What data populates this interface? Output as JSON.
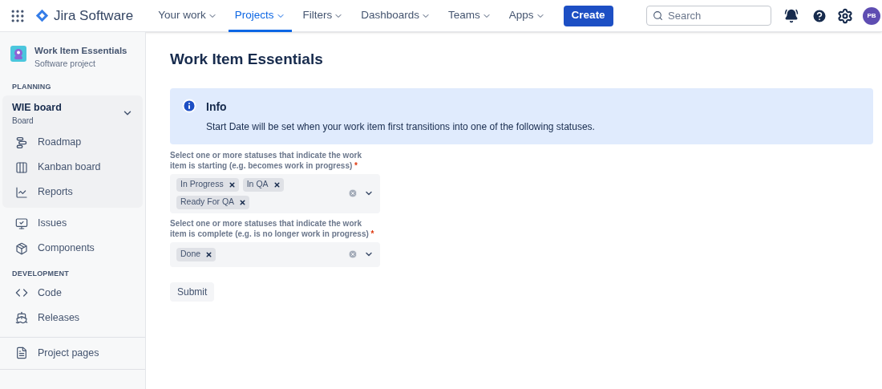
{
  "topnav": {
    "product": "Jira Software",
    "items": [
      {
        "label": "Your work",
        "selected": false
      },
      {
        "label": "Projects",
        "selected": true
      },
      {
        "label": "Filters",
        "selected": false
      },
      {
        "label": "Dashboards",
        "selected": false
      },
      {
        "label": "Teams",
        "selected": false
      },
      {
        "label": "Apps",
        "selected": false
      }
    ],
    "create": "Create",
    "search": {
      "placeholder": "Search"
    },
    "avatar": "PB"
  },
  "sidebar": {
    "project": {
      "name": "Work Item Essentials",
      "type": "Software project"
    },
    "planning_heading": "PLANNING",
    "board": {
      "name": "WIE board",
      "type": "Board",
      "expanded": true,
      "items": [
        {
          "label": "Roadmap"
        },
        {
          "label": "Kanban board"
        },
        {
          "label": "Reports"
        }
      ]
    },
    "planning_items": [
      {
        "label": "Issues"
      },
      {
        "label": "Components"
      }
    ],
    "development_heading": "DEVELOPMENT",
    "development_items": [
      {
        "label": "Code"
      },
      {
        "label": "Releases"
      }
    ],
    "footer_items": [
      {
        "label": "Project pages"
      }
    ]
  },
  "main": {
    "title": "Work Item Essentials",
    "info": {
      "title": "Info",
      "text": "Start Date will be set when your work item first transitions into one of the following statuses."
    },
    "fields": [
      {
        "label": "Select one or more statuses that indicate the work item is starting (e.g. becomes work in progress)",
        "required_mark": "*",
        "tags": [
          "In Progress",
          "In QA",
          "Ready For QA"
        ]
      },
      {
        "label": "Select one or more statuses that indicate the work item is complete (e.g. is no longer work in progress)",
        "required_mark": "*",
        "tags": [
          "Done"
        ]
      }
    ],
    "submit": "Submit"
  }
}
